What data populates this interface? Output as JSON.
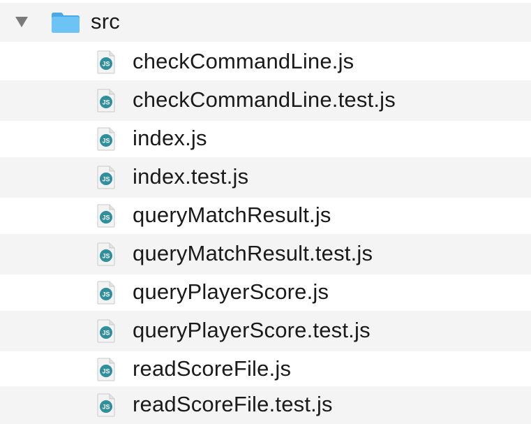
{
  "folder": {
    "name": "src",
    "expanded": true,
    "icon": "folder-icon",
    "color": "#5ab8ef"
  },
  "files": [
    {
      "name": "checkCommandLine.js",
      "icon": "js-file-icon"
    },
    {
      "name": "checkCommandLine.test.js",
      "icon": "js-file-icon"
    },
    {
      "name": "index.js",
      "icon": "js-file-icon"
    },
    {
      "name": "index.test.js",
      "icon": "js-file-icon"
    },
    {
      "name": "queryMatchResult.js",
      "icon": "js-file-icon"
    },
    {
      "name": "queryMatchResult.test.js",
      "icon": "js-file-icon"
    },
    {
      "name": "queryPlayerScore.js",
      "icon": "js-file-icon"
    },
    {
      "name": "queryPlayerScore.test.js",
      "icon": "js-file-icon"
    },
    {
      "name": "readScoreFile.js",
      "icon": "js-file-icon"
    },
    {
      "name": "readScoreFile.test.js",
      "icon": "js-file-icon"
    }
  ],
  "colors": {
    "row_alt": "#f4f4f5",
    "js_badge": "#2f8f9d",
    "text": "#1a1a1a"
  }
}
